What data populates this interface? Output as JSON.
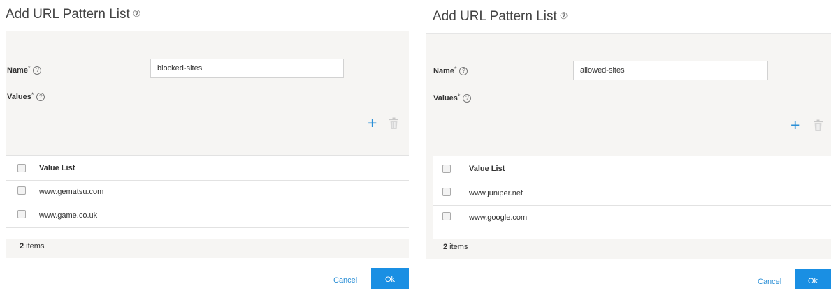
{
  "left_dialog": {
    "title": "Add URL Pattern List",
    "title_help_glyph": "⑦",
    "name_label": "Name",
    "name_required": "*",
    "name_help_glyph": "?",
    "name_value": "blocked-sites",
    "values_label": "Values",
    "values_required": "*",
    "values_help_glyph": "?",
    "add_glyph": "+",
    "column_header": "Value List",
    "rows": [
      "www.gematsu.com",
      "www.game.co.uk"
    ],
    "item_count": "2",
    "items_suffix": " items",
    "cancel_label": "Cancel",
    "ok_label": "Ok"
  },
  "right_dialog": {
    "title": "Add URL Pattern List",
    "title_help_glyph": "⑦",
    "name_label": "Name",
    "name_required": "*",
    "name_help_glyph": "?",
    "name_value": "allowed-sites",
    "values_label": "Values",
    "values_required": "*",
    "values_help_glyph": "?",
    "add_glyph": "+",
    "column_header": "Value List",
    "rows": [
      "www.juniper.net",
      "www.google.com"
    ],
    "item_count": "2",
    "items_suffix": " items",
    "cancel_label": "Cancel",
    "ok_label": "Ok"
  },
  "icons": {
    "help": "help-circle-icon",
    "add": "plus-icon",
    "delete": "trash-icon"
  },
  "colors": {
    "accent": "#1a8fe3",
    "link": "#2b8fd6",
    "panel_bg": "#f6f5f3"
  }
}
